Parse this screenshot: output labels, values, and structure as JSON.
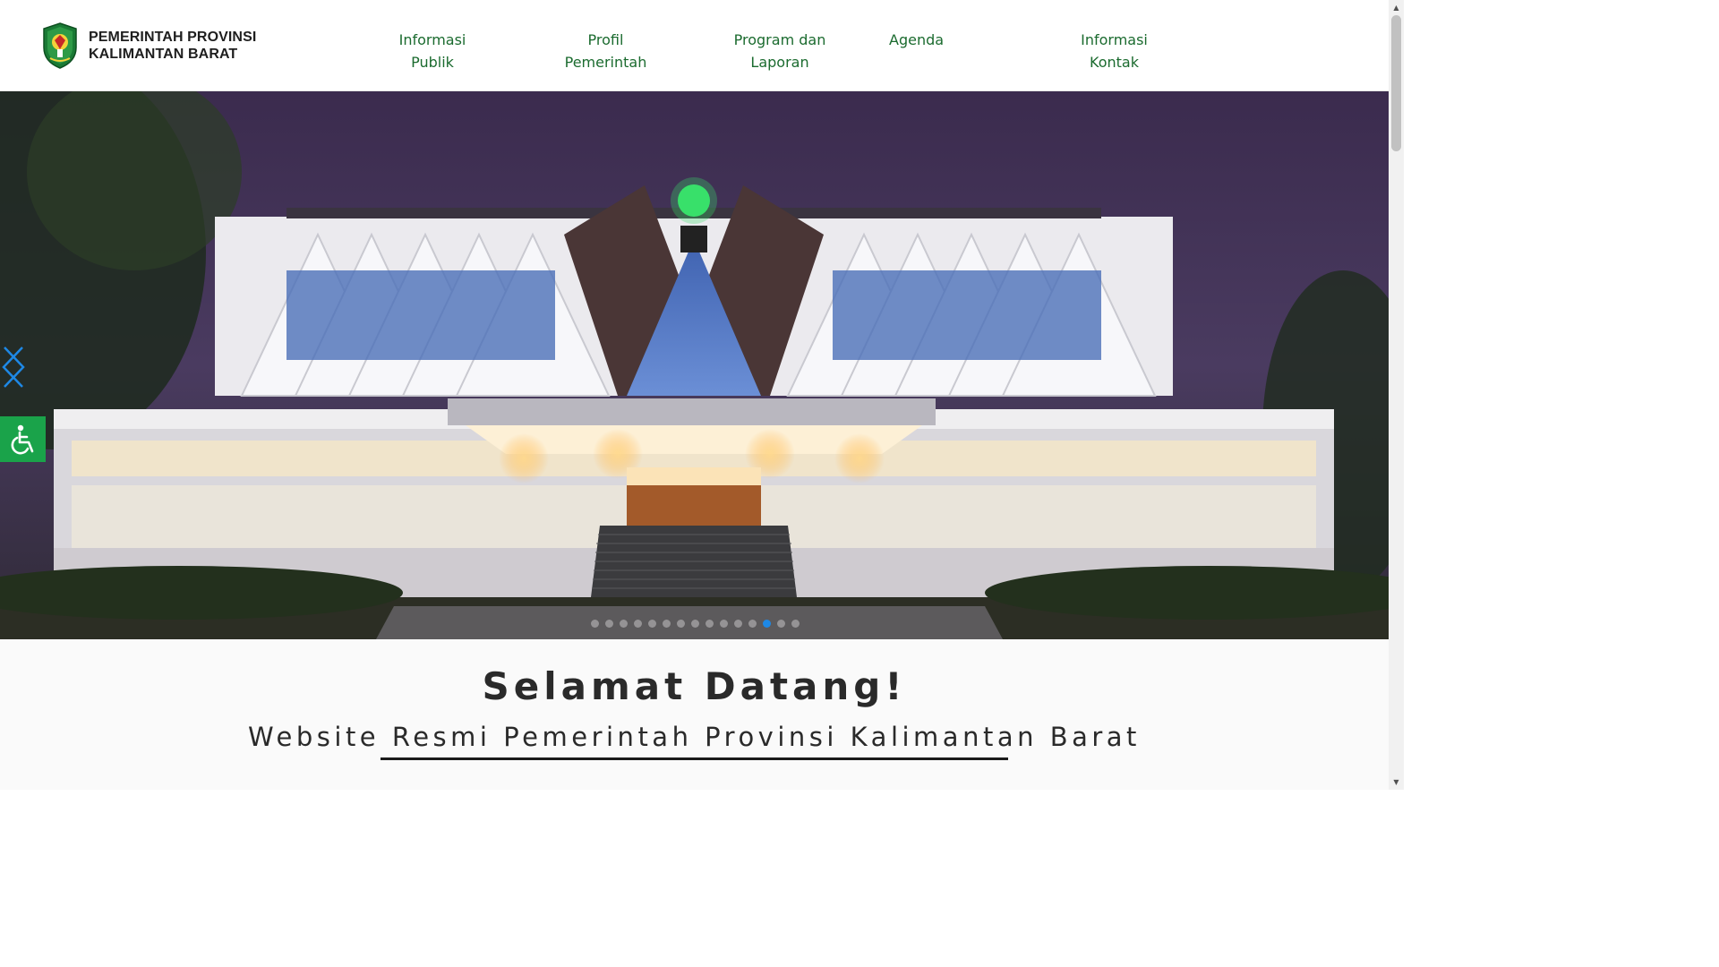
{
  "header": {
    "brand": {
      "line1": "PEMERINTAH PROVINSI",
      "line2": "KALIMANTAN BARAT",
      "logo_icon": "kalbar-crest-icon"
    },
    "nav": [
      {
        "label": "Informasi Publik"
      },
      {
        "label": "Profil Pemerintah"
      },
      {
        "label": "Program dan Laporan"
      },
      {
        "label": "Agenda"
      },
      {
        "label": "Informasi Kontak"
      }
    ]
  },
  "hero": {
    "image": "governor-office-building-night",
    "prev_icon": "chevron-left-icon",
    "next_icon": "chevron-right-icon",
    "slide_count": 15,
    "active_slide": 12
  },
  "accessibility": {
    "icon": "wheelchair-icon"
  },
  "welcome": {
    "title": "Selamat Datang!",
    "subtitle": "Website Resmi Pemerintah Provinsi Kalimantan Barat"
  },
  "colors": {
    "nav_text": "#1b6b2f",
    "accessibility_bg": "#1aa34a",
    "carousel_arrow": "#1e88e5",
    "active_indicator": "#1e88e5"
  }
}
